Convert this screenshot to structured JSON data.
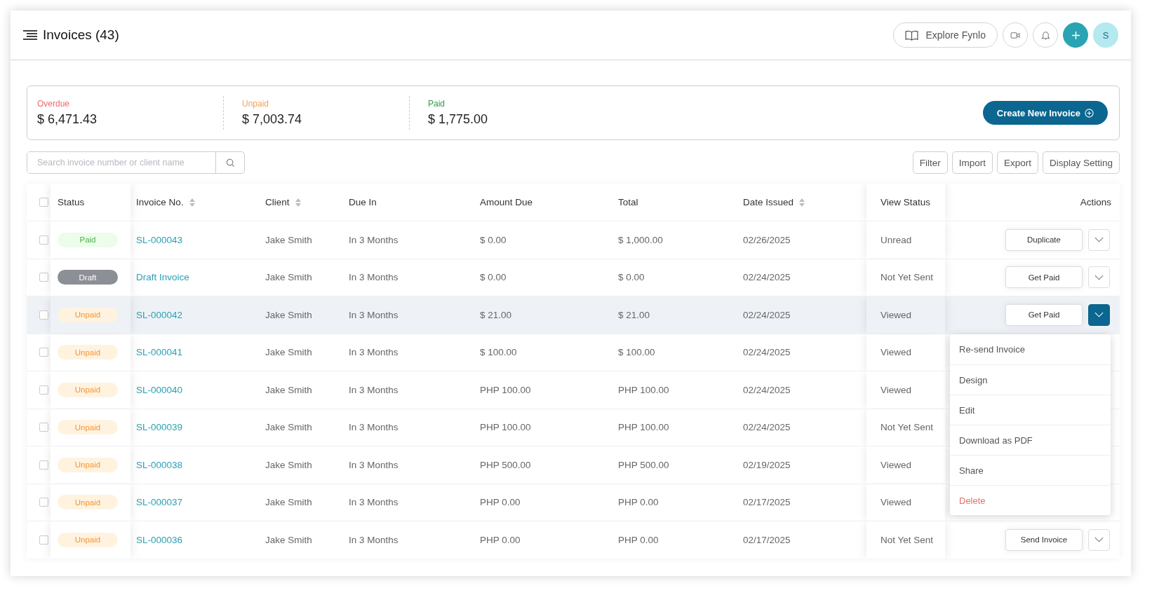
{
  "page": {
    "title": "Invoices (43)"
  },
  "topbar": {
    "explore_label": "Explore Fynlo",
    "avatar_initial": "S"
  },
  "summary": [
    {
      "kind": "overdue",
      "label": "Overdue",
      "amount": "$ 6,471.43"
    },
    {
      "kind": "unpaid",
      "label": "Unpaid",
      "amount": "$ 7,003.74"
    },
    {
      "kind": "paid",
      "label": "Paid",
      "amount": "$ 1,775.00"
    }
  ],
  "create_button": "Create New Invoice",
  "search": {
    "placeholder": "Search invoice number or client name"
  },
  "toolbar": [
    "Filter",
    "Import",
    "Export",
    "Display Setting"
  ],
  "table": {
    "all_checked": false,
    "columns": [
      {
        "label": "Status",
        "sortable": false
      },
      {
        "label": "Invoice No.",
        "sortable": true
      },
      {
        "label": "Client",
        "sortable": true
      },
      {
        "label": "Due In",
        "sortable": false
      },
      {
        "label": "Amount Due",
        "sortable": false
      },
      {
        "label": "Total",
        "sortable": false
      },
      {
        "label": "Date Issued",
        "sortable": true
      },
      {
        "label": "View Status",
        "sortable": false
      },
      {
        "label": "Actions",
        "sortable": false
      }
    ],
    "rows": [
      {
        "checked": false,
        "highlighted": false,
        "status": {
          "kind": "paid",
          "label": "Paid"
        },
        "invoice": "SL-000043",
        "client": "Jake Smith",
        "due_in": "In 3 Months",
        "amount_due": "$ 0.00",
        "total": "$ 1,000.00",
        "date_issued": "02/26/2025",
        "view_status": "Unread",
        "action": "Duplicate",
        "menu_expanded": false
      },
      {
        "checked": false,
        "highlighted": false,
        "status": {
          "kind": "draft",
          "label": "Draft"
        },
        "invoice": "Draft Invoice",
        "client": "Jake Smith",
        "due_in": "In 3 Months",
        "amount_due": "$ 0.00",
        "total": "$ 0.00",
        "date_issued": "02/24/2025",
        "view_status": "Not Yet Sent",
        "action": "Get Paid",
        "menu_expanded": false
      },
      {
        "checked": false,
        "highlighted": true,
        "status": {
          "kind": "unpaid",
          "label": "Unpaid"
        },
        "invoice": "SL-000042",
        "client": "Jake Smith",
        "due_in": "In 3 Months",
        "amount_due": "$ 21.00",
        "total": "$ 21.00",
        "date_issued": "02/24/2025",
        "view_status": "Viewed",
        "action": "Get Paid",
        "menu_expanded": true
      },
      {
        "checked": false,
        "highlighted": false,
        "status": {
          "kind": "unpaid",
          "label": "Unpaid"
        },
        "invoice": "SL-000041",
        "client": "Jake Smith",
        "due_in": "In 3 Months",
        "amount_due": "$ 100.00",
        "total": "$ 100.00",
        "date_issued": "02/24/2025",
        "view_status": "Viewed"
      },
      {
        "checked": false,
        "highlighted": false,
        "status": {
          "kind": "unpaid",
          "label": "Unpaid"
        },
        "invoice": "SL-000040",
        "client": "Jake Smith",
        "due_in": "In 3 Months",
        "amount_due": "PHP 100.00",
        "total": "PHP 100.00",
        "date_issued": "02/24/2025",
        "view_status": "Viewed"
      },
      {
        "checked": false,
        "highlighted": false,
        "status": {
          "kind": "unpaid",
          "label": "Unpaid"
        },
        "invoice": "SL-000039",
        "client": "Jake Smith",
        "due_in": "In 3 Months",
        "amount_due": "PHP 100.00",
        "total": "PHP 100.00",
        "date_issued": "02/24/2025",
        "view_status": "Not Yet Sent"
      },
      {
        "checked": false,
        "highlighted": false,
        "status": {
          "kind": "unpaid",
          "label": "Unpaid"
        },
        "invoice": "SL-000038",
        "client": "Jake Smith",
        "due_in": "In 3 Months",
        "amount_due": "PHP 500.00",
        "total": "PHP 500.00",
        "date_issued": "02/19/2025",
        "view_status": "Viewed"
      },
      {
        "checked": false,
        "highlighted": false,
        "status": {
          "kind": "unpaid",
          "label": "Unpaid"
        },
        "invoice": "SL-000037",
        "client": "Jake Smith",
        "due_in": "In 3 Months",
        "amount_due": "PHP 0.00",
        "total": "PHP 0.00",
        "date_issued": "02/17/2025",
        "view_status": "Viewed"
      },
      {
        "checked": false,
        "highlighted": false,
        "status": {
          "kind": "unpaid",
          "label": "Unpaid"
        },
        "invoice": "SL-000036",
        "client": "Jake Smith",
        "due_in": "In 3 Months",
        "amount_due": "PHP 0.00",
        "total": "PHP 0.00",
        "date_issued": "02/17/2025",
        "view_status": "Not Yet Sent",
        "action": "Send Invoice",
        "menu_expanded": false
      }
    ]
  },
  "action_menu": [
    {
      "kind": "normal",
      "label": "Re-send Invoice"
    },
    {
      "kind": "normal",
      "label": "Design"
    },
    {
      "kind": "normal",
      "label": "Edit"
    },
    {
      "kind": "normal",
      "label": "Download as PDF"
    },
    {
      "kind": "normal",
      "label": "Share"
    },
    {
      "kind": "danger",
      "label": "Delete"
    }
  ]
}
